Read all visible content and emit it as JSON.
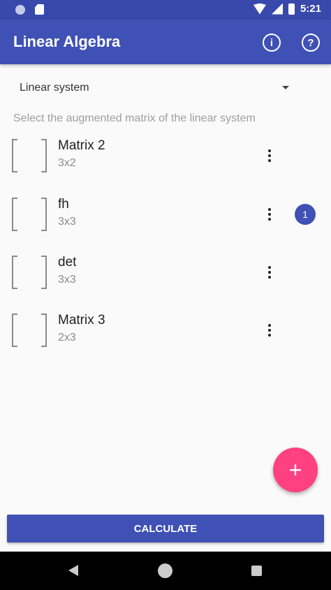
{
  "status_bar": {
    "time": "5:21",
    "left_icons": [
      "notification-dot-icon",
      "sd-card-icon"
    ],
    "right_icons": [
      "wifi-icon",
      "signal-icon",
      "battery-icon"
    ]
  },
  "app_bar": {
    "title": "Linear Algebra",
    "info_glyph": "i",
    "help_glyph": "?"
  },
  "spinner": {
    "selected": "Linear system"
  },
  "instruction": "Select the augmented matrix of the linear system",
  "matrices": [
    {
      "name": "Matrix 2",
      "dims": "3x2",
      "badge": ""
    },
    {
      "name": "fh",
      "dims": "3x3",
      "badge": "1"
    },
    {
      "name": "det",
      "dims": "3x3",
      "badge": ""
    },
    {
      "name": "Matrix 3",
      "dims": "2x3",
      "badge": ""
    }
  ],
  "fab": {
    "glyph": "+"
  },
  "calculate_label": "CALCULATE",
  "colors": {
    "primary": "#3f51b5",
    "primary_dark": "#3949ab",
    "accent": "#ff4081"
  }
}
